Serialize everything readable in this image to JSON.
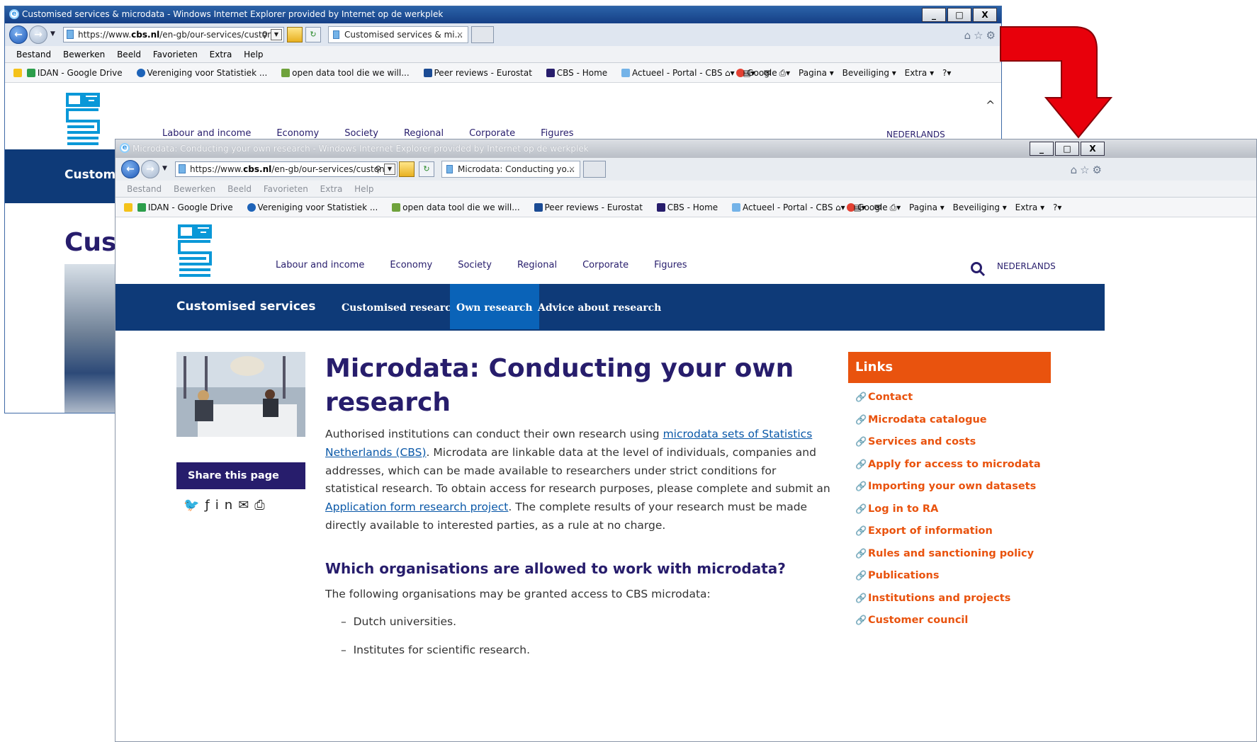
{
  "back_window": {
    "title": "Customised services & microdata - Windows Internet Explorer provided by Internet op de werkplek",
    "url_prefix": "https://www.",
    "url_domain": "cbs.nl",
    "url_rest": "/en-gb/our-services/custon",
    "tab_label": "Customised services & mi...",
    "menu": [
      "Bestand",
      "Bewerken",
      "Beeld",
      "Favorieten",
      "Extra",
      "Help"
    ],
    "nav": [
      "Labour and income",
      "Economy",
      "Society",
      "Regional",
      "Corporate",
      "Figures"
    ],
    "lang": "NEDERLANDS",
    "bar_title": "Custom",
    "heading": "Cus"
  },
  "front_window": {
    "title": "Microdata: Conducting your own research - Windows Internet Explorer provided by Internet op de werkplek",
    "url_prefix": "https://www.",
    "url_domain": "cbs.nl",
    "url_rest": "/en-gb/our-services/custon",
    "tab_label": "Microdata: Conducting yo...",
    "menu": [
      "Bestand",
      "Bewerken",
      "Beeld",
      "Favorieten",
      "Extra",
      "Help"
    ]
  },
  "window_buttons": {
    "minimize": "_",
    "maximize": "□",
    "close": "X"
  },
  "favorites": [
    "IDAN - Google Drive",
    "Vereniging voor Statistiek ...",
    "open data tool die we will...",
    "Peer reviews - Eurostat",
    "CBS - Home",
    "Actueel - Portal - CBS",
    "Google"
  ],
  "command_bar": [
    "Pagina ▾",
    "Beveiliging ▾",
    "Extra ▾"
  ],
  "site": {
    "nav": [
      "Labour and income",
      "Economy",
      "Society",
      "Regional",
      "Corporate",
      "Figures"
    ],
    "lang": "NEDERLANDS",
    "section_title": "Customised services",
    "subnav": [
      "Customised research",
      "Own research",
      "Advice about research"
    ],
    "active_subnav": "Own research",
    "h1": "Microdata: Conducting your own research",
    "intro_1": "Authorised institutions can conduct their own research using ",
    "intro_link_1": "microdata sets of Statistics Netherlands (CBS)",
    "intro_2": ". Microdata are linkable data at the level of individuals, companies and addresses, which can be made available to researchers under strict conditions for statistical research. To obtain access for research purposes, please complete and submit an ",
    "intro_link_2": "Application form research project",
    "intro_3": ". The complete results of your research must be made directly available to interested parties, as a rule at no charge.",
    "h2": "Which organisations are allowed to work with microdata?",
    "orgs_intro": "The following organisations may be granted access to CBS microdata:",
    "orgs": [
      "Dutch universities.",
      "Institutes for scientific research."
    ],
    "share_label": "Share this page",
    "social_icons": [
      "twitter-icon",
      "facebook-icon",
      "linkedin-icon",
      "mail-icon",
      "print-icon"
    ],
    "links_title": "Links",
    "links": [
      "Contact",
      "Microdata catalogue",
      "Services and costs",
      "Apply for access to microdata",
      "Importing your own datasets",
      "Log in to RA",
      "Export of information",
      "Rules and sanctioning policy",
      "Publications",
      "Institutions and projects",
      "Customer council"
    ]
  },
  "colors": {
    "cbs_blue": "#271D6C",
    "bar_blue": "#0e3a78",
    "active_blue": "#0a63b8",
    "orange": "#e9530e",
    "arrow_red": "#e8000b"
  }
}
